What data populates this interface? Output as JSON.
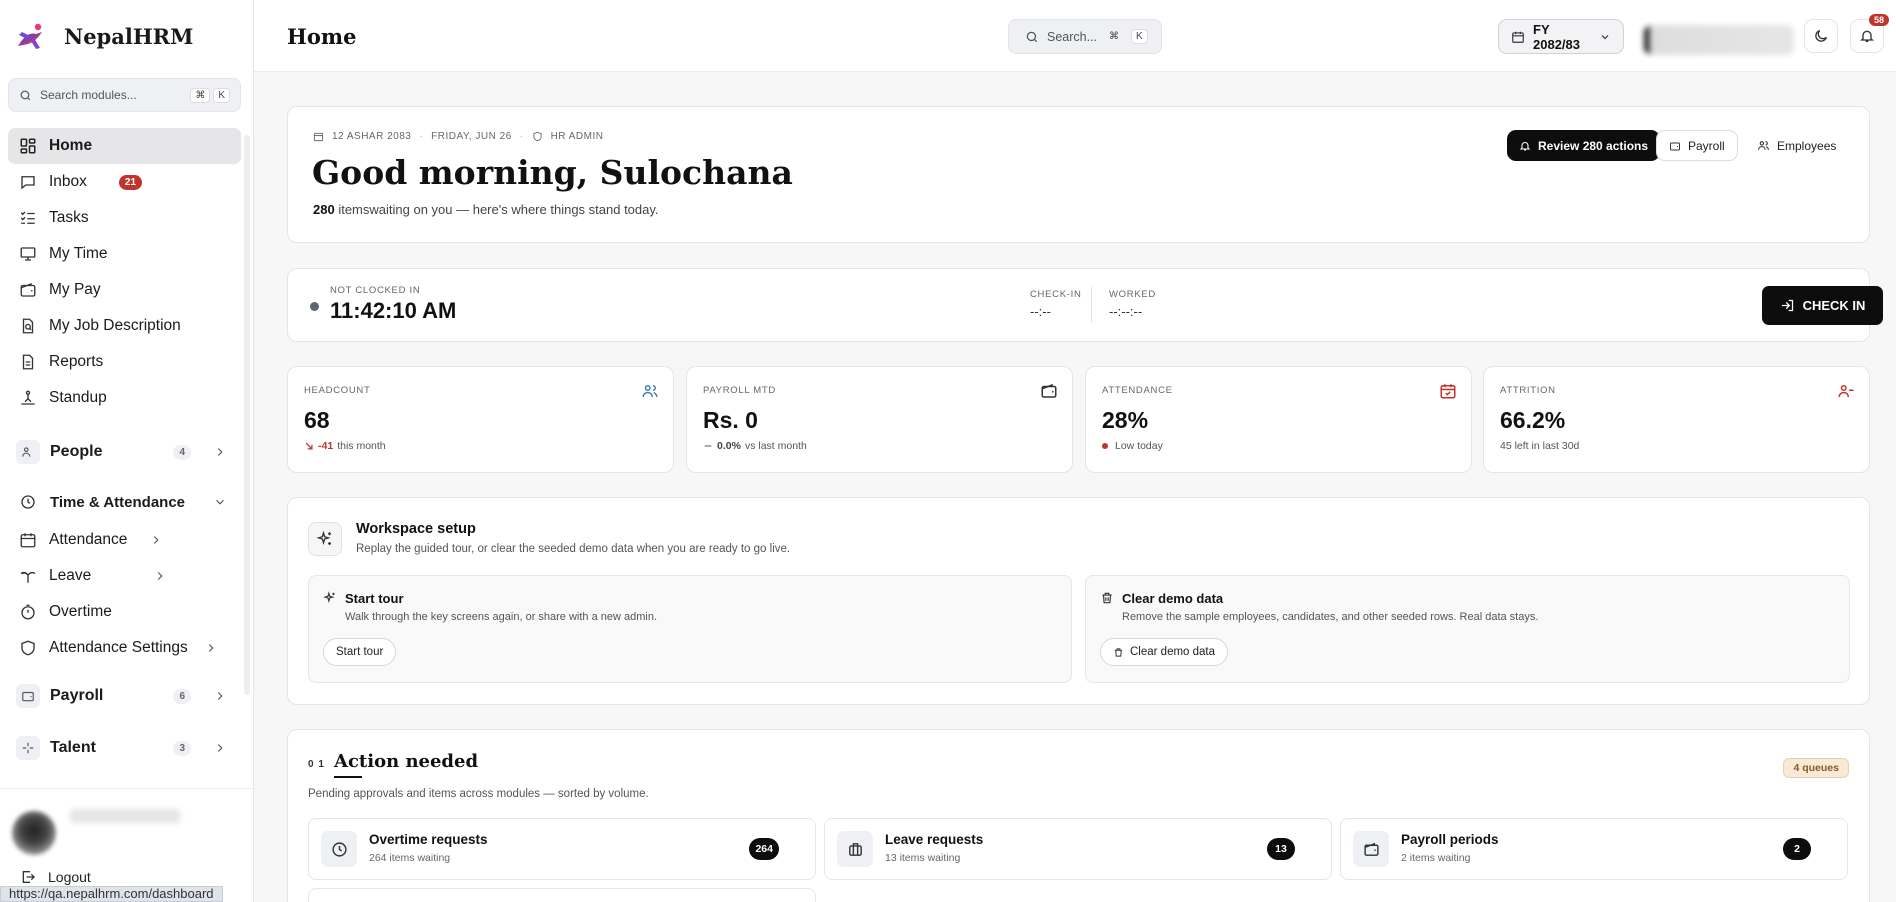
{
  "brand": {
    "name": "NepalHRM"
  },
  "sidebar": {
    "search_placeholder": "Search modules...",
    "kbd": [
      "⌘",
      "K"
    ],
    "items": [
      {
        "label": "Home",
        "icon": "dashboard-icon",
        "active": true
      },
      {
        "label": "Inbox",
        "icon": "inbox-icon",
        "badge": "21"
      },
      {
        "label": "Tasks",
        "icon": "tasks-icon"
      },
      {
        "label": "My Time",
        "icon": "monitor-icon"
      },
      {
        "label": "My Pay",
        "icon": "wallet-icon"
      },
      {
        "label": "My Job Description",
        "icon": "briefcase-icon"
      },
      {
        "label": "Reports",
        "icon": "document-icon"
      },
      {
        "label": "Standup",
        "icon": "standup-icon"
      }
    ],
    "groups": {
      "people": {
        "label": "People",
        "count": "4"
      },
      "time": {
        "label": "Time & Attendance"
      },
      "payroll": {
        "label": "Payroll",
        "count": "6"
      },
      "talent": {
        "label": "Talent",
        "count": "3"
      }
    },
    "time_items": [
      {
        "label": "Attendance"
      },
      {
        "label": "Leave"
      },
      {
        "label": "Overtime"
      },
      {
        "label": "Attendance Settings"
      }
    ],
    "logout": "Logout",
    "url": "https://qa.nepalhrm.com/dashboard"
  },
  "topbar": {
    "title": "Home",
    "search_placeholder": "Search...",
    "kbd": [
      "⌘",
      "K"
    ],
    "fiscal_year": "FY 2082/83",
    "notifications": "58"
  },
  "hero": {
    "date_np": "12 ASHAR 2083",
    "date_en": "FRIDAY, JUN 26",
    "role": "HR ADMIN",
    "greeting": "Good morning, Sulochana",
    "count": "280",
    "subtitle": "itemswaiting on you — here's where things stand today.",
    "review_btn": "Review 280 actions",
    "payroll_btn": "Payroll",
    "employees_btn": "Employees"
  },
  "clock": {
    "status": "NOT CLOCKED IN",
    "time": "11:42:10 AM",
    "checkin_label": "CHECK-IN",
    "checkin_value": "--:--",
    "worked_label": "WORKED",
    "worked_value": "--:--:--",
    "button": "CHECK IN"
  },
  "stats": [
    {
      "label": "HEADCOUNT",
      "value": "68",
      "delta": "-41",
      "foot": "this month",
      "icon": "users-icon",
      "color": "#3b82b6"
    },
    {
      "label": "PAYROLL MTD",
      "value": "Rs. 0",
      "delta": "0.0%",
      "foot": "vs last month",
      "icon": "wallet-icon",
      "color": "#333333"
    },
    {
      "label": "ATTENDANCE",
      "value": "28%",
      "foot": "Low today",
      "icon": "calendar-check-icon",
      "color": "#c0342b"
    },
    {
      "label": "ATTRITION",
      "value": "66.2%",
      "foot": "45 left in last 30d",
      "icon": "user-minus-icon",
      "color": "#c0342b"
    }
  ],
  "workspace": {
    "title": "Workspace setup",
    "subtitle": "Replay the guided tour, or clear the seeded demo data when you are ready to go live.",
    "tour": {
      "title": "Start tour",
      "desc": "Walk through the key screens again, or share with a new admin.",
      "button": "Start tour"
    },
    "clear": {
      "title": "Clear demo data",
      "desc": "Remove the sample employees, candidates, and other seeded rows. Real data stays.",
      "button": "Clear demo data"
    }
  },
  "actions": {
    "index": "0 1",
    "title": "Action needed",
    "subtitle": "Pending approvals and items across modules — sorted by volume.",
    "queues_badge": "4 queues",
    "queues": [
      {
        "title": "Overtime requests",
        "sub": "264 items waiting",
        "count": "264",
        "icon": "clock-icon"
      },
      {
        "title": "Leave requests",
        "sub": "13 items waiting",
        "count": "13",
        "icon": "suitcase-icon"
      },
      {
        "title": "Payroll periods",
        "sub": "2 items waiting",
        "count": "2",
        "icon": "wallet-icon"
      }
    ]
  },
  "colors": {
    "accent_dark": "#0d0d0d",
    "danger": "#c0342b",
    "brand_purple": "#6b4bd8"
  }
}
